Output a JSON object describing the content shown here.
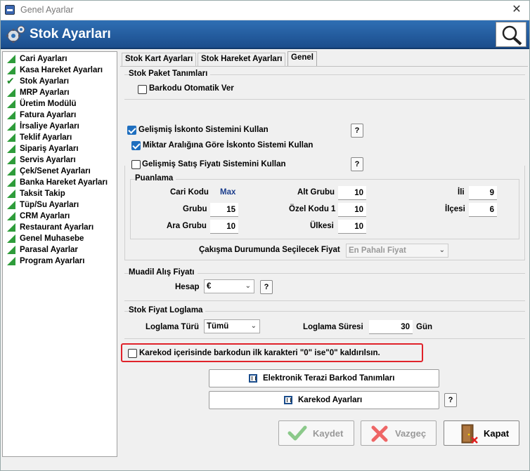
{
  "window": {
    "title": "Genel Ayarlar",
    "close": "✕"
  },
  "header": {
    "title": "Stok Ayarları"
  },
  "tree": [
    {
      "label": "Cari Ayarları",
      "icon": "triangle"
    },
    {
      "label": "Kasa Hareket Ayarları",
      "icon": "triangle"
    },
    {
      "label": "Stok Ayarları",
      "icon": "check"
    },
    {
      "label": "MRP Ayarları",
      "icon": "triangle"
    },
    {
      "label": "Üretim Modülü",
      "icon": "triangle"
    },
    {
      "label": "Fatura Ayarları",
      "icon": "triangle"
    },
    {
      "label": "İrsaliye Ayarları",
      "icon": "triangle"
    },
    {
      "label": "Teklif Ayarları",
      "icon": "triangle"
    },
    {
      "label": "Sipariş Ayarları",
      "icon": "triangle"
    },
    {
      "label": "Servis Ayarları",
      "icon": "triangle"
    },
    {
      "label": "Çek/Senet Ayarları",
      "icon": "triangle"
    },
    {
      "label": "Banka Hareket Ayarları",
      "icon": "triangle"
    },
    {
      "label": "Taksit Takip",
      "icon": "triangle"
    },
    {
      "label": "Tüp/Su Ayarları",
      "icon": "triangle"
    },
    {
      "label": "CRM Ayarları",
      "icon": "triangle"
    },
    {
      "label": "Restaurant Ayarları",
      "icon": "triangle"
    },
    {
      "label": "Genel Muhasebe",
      "icon": "triangle"
    },
    {
      "label": "Parasal Ayarlar",
      "icon": "triangle"
    },
    {
      "label": "Program Ayarları",
      "icon": "triangle"
    }
  ],
  "tabs": {
    "t1": "Stok Kart Ayarları",
    "t2": "Stok Hareket Ayarları",
    "t3": "Genel",
    "active": "t3"
  },
  "paket": {
    "title": "Stok Paket Tanımları",
    "barkod_auto": {
      "label": "Barkodu Otomatik Ver",
      "checked": false
    }
  },
  "iskonto": {
    "gelismis": {
      "label": "Gelişmiş İskonto Sistemini Kullan",
      "checked": true
    },
    "miktar": {
      "label": "Miktar Aralığına Göre İskonto Sistemi Kullan",
      "checked": true
    },
    "help": "?"
  },
  "satis": {
    "label": "Gelişmiş Satış Fiyatı Sistemini Kullan",
    "checked": false,
    "help": "?",
    "puanlama": {
      "title": "Puanlama",
      "cari_kodu": {
        "label": "Cari Kodu",
        "value": "Max"
      },
      "grubu": {
        "label": "Grubu",
        "value": "15"
      },
      "ara_grubu": {
        "label": "Ara Grubu",
        "value": "10"
      },
      "alt_grubu": {
        "label": "Alt Grubu",
        "value": "10"
      },
      "ozel_kodu": {
        "label": "Özel Kodu 1",
        "value": "10"
      },
      "ulkesi": {
        "label": "Ülkesi",
        "value": "10"
      },
      "ili": {
        "label": "İli",
        "value": "9"
      },
      "ilcesi": {
        "label": "İlçesi",
        "value": "6"
      }
    },
    "cakisma": {
      "label": "Çakışma Durumunda Seçilecek Fiyat",
      "value": "En Pahalı Fiyat"
    }
  },
  "muadil": {
    "title": "Muadil Alış Fiyatı",
    "hesap": {
      "label": "Hesap",
      "value": "€"
    },
    "help": "?"
  },
  "loglama": {
    "title": "Stok Fiyat Loglama",
    "turu": {
      "label": "Loglama Türü",
      "value": "Tümü"
    },
    "suresi": {
      "label": "Loglama Süresi",
      "value": "30",
      "unit": "Gün"
    }
  },
  "karekod_cb": {
    "label": "Karekod içerisinde barkodun ilk karakteri \"0\" ise\"0\" kaldırılsın.",
    "checked": false
  },
  "buttons": {
    "terazi": "Elektronik Terazi Barkod Tanımları",
    "karekod": "Karekod Ayarları",
    "karekod_help": "?",
    "kaydet": "Kaydet",
    "vazgec": "Vazgeç",
    "kapat": "Kapat"
  },
  "colors": {
    "header": "#1f5799",
    "accent": "#1f6fbf",
    "highlight": "#e0222a",
    "tree_icon": "#2e9c3a"
  }
}
